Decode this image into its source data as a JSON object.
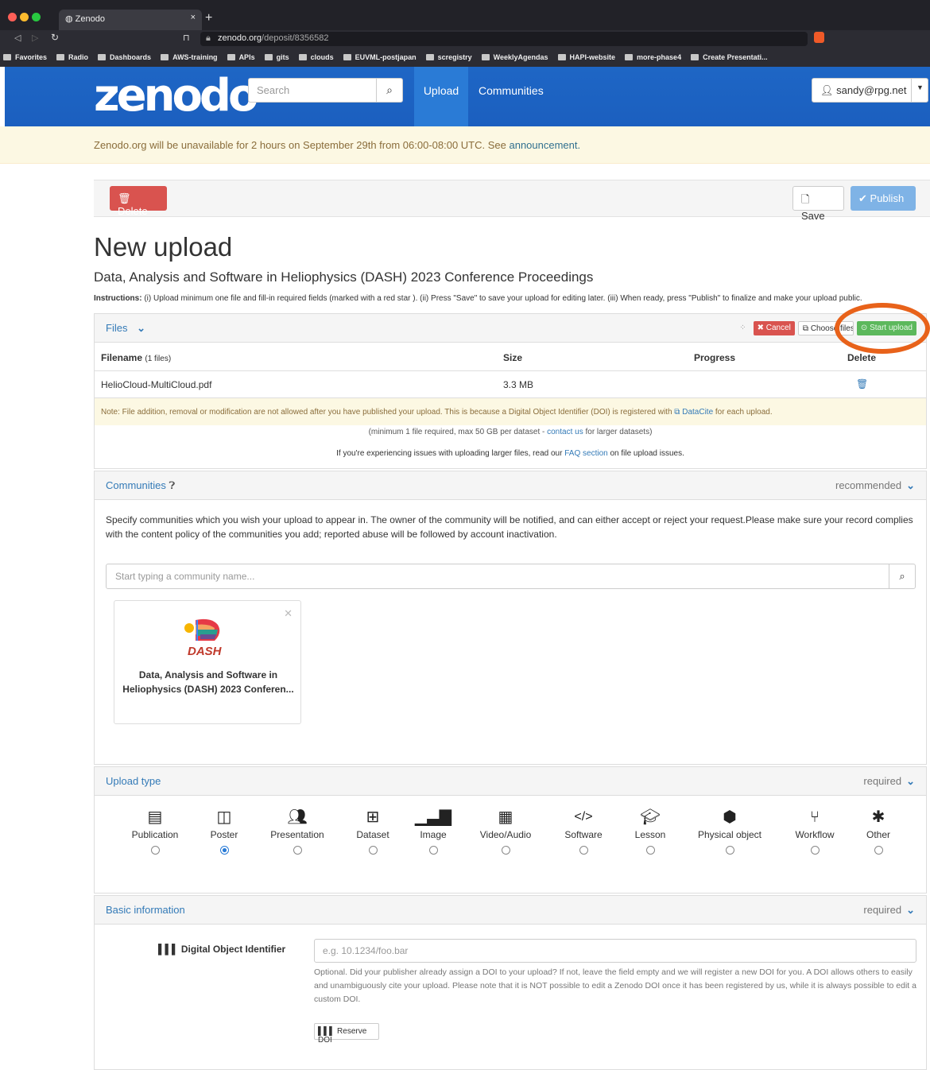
{
  "browser": {
    "tab_title": "Zenodo",
    "url_host": "zenodo.org",
    "url_path": "/deposit/8356582",
    "bookmarks": [
      "Favorites",
      "Radio",
      "Dashboards",
      "AWS-training",
      "APIs",
      "gits",
      "clouds",
      "EUVML-postjapan",
      "scregistry",
      "WeeklyAgendas",
      "HAPI-website",
      "more-phase4",
      "Create Presentati..."
    ]
  },
  "nav": {
    "logo": "zenodo",
    "search_placeholder": "Search",
    "upload": "Upload",
    "communities": "Communities",
    "user": "sandy@rpg.net"
  },
  "banner": {
    "text": "Zenodo.org will be unavailable for 2 hours on September 29th from 06:00-08:00 UTC. See ",
    "link": "announcement."
  },
  "toolbar": {
    "delete": "Delete",
    "save": "Save",
    "publish": "Publish"
  },
  "page": {
    "title": "New upload",
    "subtitle": "Data, Analysis and Software in Heliophysics (DASH) 2023 Conference Proceedings",
    "instr_label": "Instructions:",
    "instructions": " (i) Upload minimum one file and fill-in required fields (marked with a red star ). (ii) Press \"Save\" to save your upload for editing later. (iii) When ready, press \"Publish\" to finalize and make your upload public."
  },
  "files": {
    "header": "Files",
    "cancel": "Cancel",
    "choose": "Choose files",
    "start": "Start upload",
    "col_filename": "Filename",
    "col_count": "(1 files)",
    "col_size": "Size",
    "col_progress": "Progress",
    "col_delete": "Delete",
    "rows": [
      {
        "name": "HelioCloud-MultiCloud.pdf",
        "size": "3.3 MB"
      }
    ],
    "note": "Note: File addition, removal or modification are not allowed after you have published your upload. This is because a Digital Object Identifier (DOI) is registered with ",
    "note_link": "DataCite",
    "note_end": " for each upload.",
    "min_a": "(minimum 1 file required, max 50 GB per dataset - ",
    "min_link": "contact us",
    "min_b": " for larger datasets)",
    "faq_a": "If you're experiencing issues with uploading larger files, read our ",
    "faq_link": "FAQ section",
    "faq_b": " on file upload issues."
  },
  "communities": {
    "header": "Communities",
    "status": "recommended",
    "desc": "Specify communities which you wish your upload to appear in. The owner of the community will be notified, and can either accept or reject your request.Please make sure your record complies with the content policy of the communities you add; reported abuse will be followed by account inactivation.",
    "placeholder": "Start typing a community name...",
    "logo_text": "DASH",
    "card_title": "Data, Analysis and Software in Heliophysics (DASH) 2023 Conferen..."
  },
  "upload_type": {
    "header": "Upload type",
    "status": "required",
    "selected": "Poster",
    "types": [
      "Publication",
      "Poster",
      "Presentation",
      "Dataset",
      "Image",
      "Video/Audio",
      "Software",
      "Lesson",
      "Physical object",
      "Workflow",
      "Other"
    ]
  },
  "basic": {
    "header": "Basic information",
    "status": "required",
    "doi_label": "Digital Object Identifier",
    "doi_placeholder": "e.g. 10.1234/foo.bar",
    "doi_help": "Optional. Did your publisher already assign a DOI to your upload? If not, leave the field empty and we will register a new DOI for you. A DOI allows others to easily and unambiguously cite your upload. Please note that it is NOT possible to edit a Zenodo DOI once it has been registered by us, while it is always possible to edit a custom DOI.",
    "reserve": "Reserve DOI"
  },
  "colors": {
    "nav": "#1e66c5",
    "danger": "#d9534f",
    "success": "#5cb85c",
    "highlight": "#e8621a",
    "link": "#337ab7"
  }
}
